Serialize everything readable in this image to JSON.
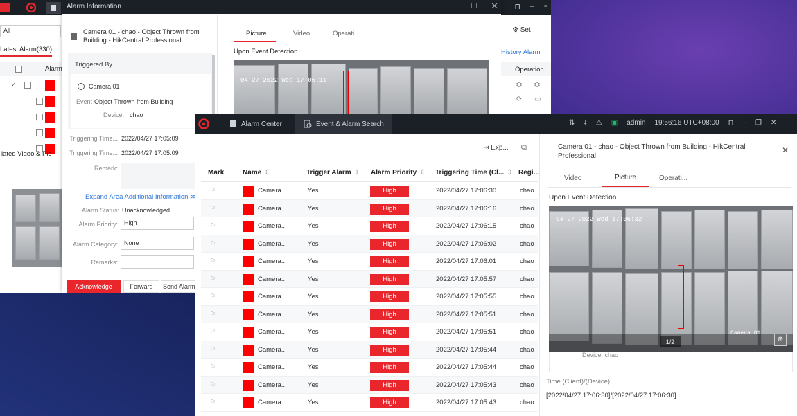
{
  "back_window": {
    "dialog_title": "Alarm Information",
    "event_title": "Camera 01 - chao - Object Thrown from Building - HikCentral Professional",
    "tabs": [
      "Picture",
      "Video",
      "Operati..."
    ],
    "active_tab": "Picture",
    "upon_event_label": "Upon Event Detection",
    "triggered_by_header": "Triggered By",
    "camera_label": "Camera 01",
    "event_label": "Event",
    "event_value": "Object Thrown from Building",
    "device_label": "Device:",
    "device_value": "chao",
    "triggering_time_label_1": "Triggering Time...",
    "triggering_time_value_1": "2022/04/27 17:05:09",
    "triggering_time_label_2": "Triggering Time...",
    "triggering_time_value_2": "2022/04/27 17:05:09",
    "remark_label": "Remark:",
    "expand_link": "Expand Area Additional Information",
    "alarm_status_label": "Alarm Status:",
    "alarm_status_value": "Unacknowledged",
    "alarm_priority_label": "Alarm Priority:",
    "alarm_priority_value": "High",
    "alarm_category_label": "Alarm Category:",
    "alarm_category_value": "None",
    "remarks_label": "Remarks:",
    "buttons": {
      "acknowledge": "Acknowledge",
      "forward": "Forward",
      "send_alarm": "Send Alarm"
    },
    "search_value": "All",
    "latest_alarm": "Latest Alarm(330)",
    "alarm_col": "Alarm",
    "related_video": "lated Video & Pic",
    "set_label": "Set",
    "history_alarm": "History Alarm",
    "operation_col": "Operation",
    "timestamp_overlay": "04-27-2022 Wed 17:05:11",
    "time_fragment": "00"
  },
  "front_window": {
    "tabs": [
      {
        "label": "Alarm Center"
      },
      {
        "label": "Event & Alarm Search"
      }
    ],
    "user": "admin",
    "clock": "19:56:16 UTC+08:00",
    "export_label": "Exp...",
    "columns": [
      "Mark",
      "Name",
      "Trigger Alarm",
      "Alarm Priority",
      "Triggering Time (Cl...",
      "Regi..."
    ],
    "rows": [
      {
        "name": "Camera...",
        "trigger": "Yes",
        "priority": "High",
        "time": "2022/04/27 17:06:30",
        "region": "chao"
      },
      {
        "name": "Camera...",
        "trigger": "Yes",
        "priority": "High",
        "time": "2022/04/27 17:06:16",
        "region": "chao"
      },
      {
        "name": "Camera...",
        "trigger": "Yes",
        "priority": "High",
        "time": "2022/04/27 17:06:15",
        "region": "chao"
      },
      {
        "name": "Camera...",
        "trigger": "Yes",
        "priority": "High",
        "time": "2022/04/27 17:06:02",
        "region": "chao"
      },
      {
        "name": "Camera...",
        "trigger": "Yes",
        "priority": "High",
        "time": "2022/04/27 17:06:01",
        "region": "chao"
      },
      {
        "name": "Camera...",
        "trigger": "Yes",
        "priority": "High",
        "time": "2022/04/27 17:05:57",
        "region": "chao"
      },
      {
        "name": "Camera...",
        "trigger": "Yes",
        "priority": "High",
        "time": "2022/04/27 17:05:55",
        "region": "chao"
      },
      {
        "name": "Camera...",
        "trigger": "Yes",
        "priority": "High",
        "time": "2022/04/27 17:05:51",
        "region": "chao"
      },
      {
        "name": "Camera...",
        "trigger": "Yes",
        "priority": "High",
        "time": "2022/04/27 17:05:51",
        "region": "chao"
      },
      {
        "name": "Camera...",
        "trigger": "Yes",
        "priority": "High",
        "time": "2022/04/27 17:05:44",
        "region": "chao"
      },
      {
        "name": "Camera...",
        "trigger": "Yes",
        "priority": "High",
        "time": "2022/04/27 17:05:44",
        "region": "chao"
      },
      {
        "name": "Camera...",
        "trigger": "Yes",
        "priority": "High",
        "time": "2022/04/27 17:05:43",
        "region": "chao"
      },
      {
        "name": "Camera...",
        "trigger": "Yes",
        "priority": "High",
        "time": "2022/04/27 17:05:43",
        "region": "chao"
      }
    ],
    "detail": {
      "title": "Camera 01 - chao - Object Thrown from Building - HikCentral Professional",
      "tabs": [
        "Video",
        "Picture",
        "Operati..."
      ],
      "active_tab": "Picture",
      "upon_event_label": "Upon Event Detection",
      "timestamp_overlay": "04-27-2022 Wed 17:06:32",
      "page_indicator": "1/2",
      "camera_overlay": "Camera 01",
      "device_fragment": "Device:  chao",
      "time_label": "Time (Client)/(Device):",
      "time_value": "[2022/04/27 17:06:30]/[2022/04/27 17:06:30]"
    }
  },
  "colors": {
    "accent_red": "#e8262c",
    "link_blue": "#2a74d6",
    "titlebar": "#1b1f26"
  }
}
